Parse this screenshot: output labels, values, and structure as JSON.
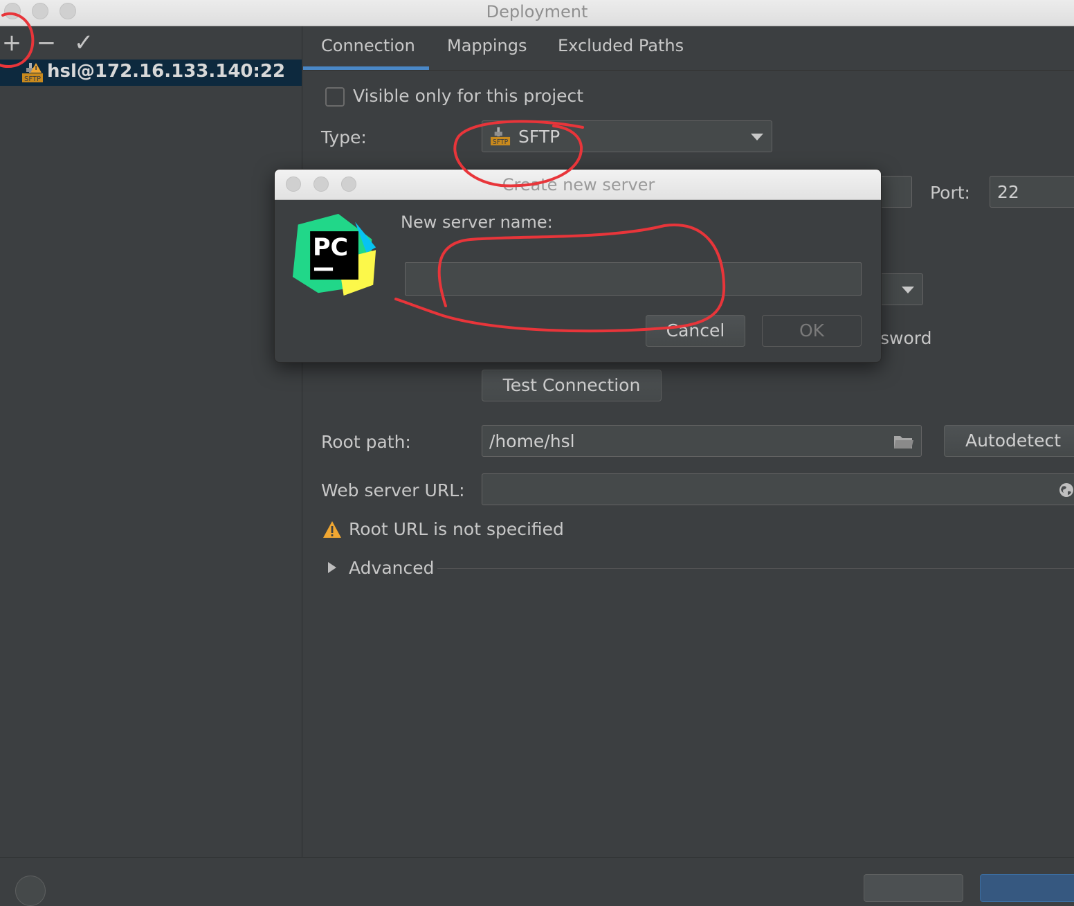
{
  "window": {
    "title": "Deployment"
  },
  "sidebar": {
    "toolbar": {
      "add": "+",
      "remove": "−",
      "apply": "✓"
    },
    "server": {
      "label": "hsl@172.16.133.140:22",
      "icon_text": "SFTP"
    }
  },
  "tabs": [
    {
      "label": "Connection"
    },
    {
      "label": "Mappings"
    },
    {
      "label": "Excluded Paths"
    }
  ],
  "connection": {
    "visible_only_label": "Visible only for this project",
    "type_label": "Type:",
    "type_value": "SFTP",
    "type_icon_text": "SFTP",
    "port_label": "Port:",
    "port_value": "22",
    "password_partial": "sword",
    "test_connection": "Test Connection",
    "root_path_label": "Root path:",
    "root_path_value": "/home/hsl",
    "autodetect": "Autodetect",
    "web_url_label": "Web server URL:",
    "warning": "Root URL is not specified",
    "advanced": "Advanced"
  },
  "modal": {
    "title": "Create new server",
    "name_label": "New server name:",
    "name_value": "",
    "cancel": "Cancel",
    "ok": "OK",
    "logo_text": "PC"
  },
  "colors": {
    "accent": "#4a88c7",
    "background": "#3c3f41",
    "selection": "#0d293e",
    "warning": "#f0a732",
    "annotation": "#e8353a"
  }
}
